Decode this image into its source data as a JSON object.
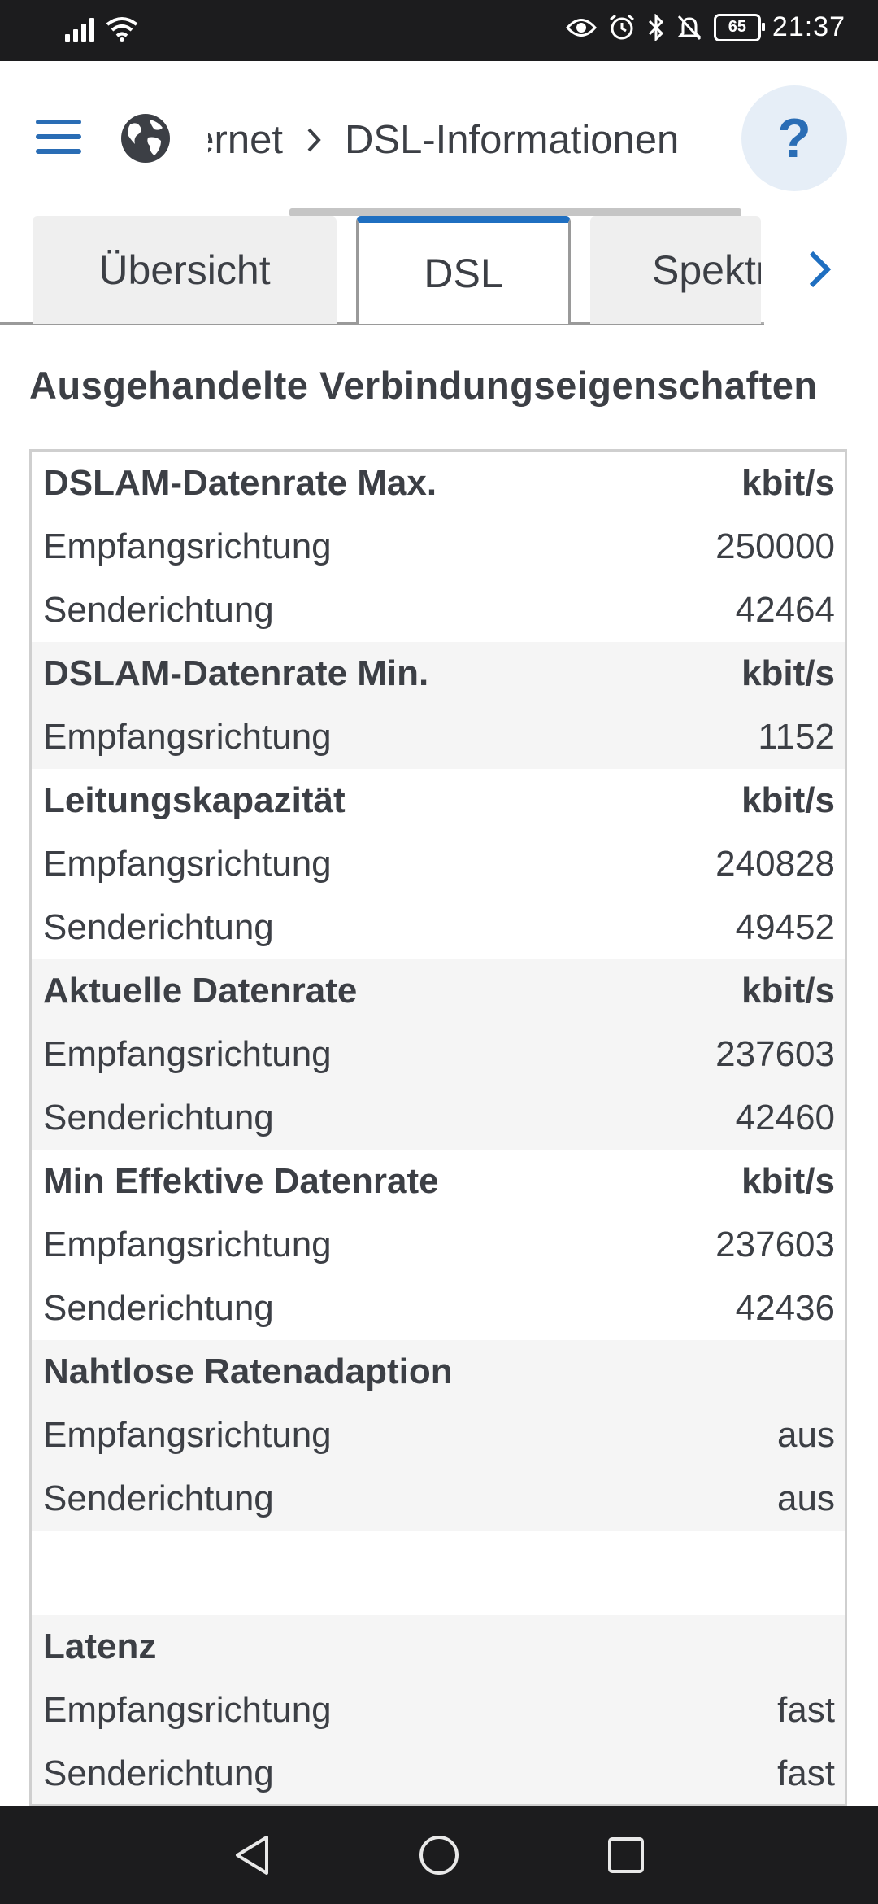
{
  "status_bar": {
    "icons": [
      "signal-icon",
      "wifi-icon",
      "eye-icon",
      "alarm-icon",
      "bluetooth-icon",
      "mute-icon",
      "battery-icon"
    ],
    "battery": "65",
    "time": "21:37"
  },
  "header": {
    "breadcrumb": {
      "parent": "Internet",
      "current": "DSL-Informationen"
    },
    "help_label": "?"
  },
  "tabs": [
    {
      "label": "Übersicht",
      "active": false
    },
    {
      "label": "DSL",
      "active": true
    },
    {
      "label": "Spektrum",
      "active": false
    }
  ],
  "section_title": "Ausgehandelte Verbindungseigenschaften",
  "table": {
    "groups": [
      {
        "title": "DSLAM-Datenrate Max.",
        "unit": "kbit/s",
        "rows": [
          {
            "label": "Empfangsrichtung",
            "value": "250000"
          },
          {
            "label": "Senderichtung",
            "value": "42464"
          }
        ]
      },
      {
        "title": "DSLAM-Datenrate Min.",
        "unit": "kbit/s",
        "rows": [
          {
            "label": "Empfangsrichtung",
            "value": "1152"
          }
        ]
      },
      {
        "title": "Leitungskapazität",
        "unit": "kbit/s",
        "rows": [
          {
            "label": "Empfangsrichtung",
            "value": "240828"
          },
          {
            "label": "Senderichtung",
            "value": "49452"
          }
        ]
      },
      {
        "title": "Aktuelle Datenrate",
        "unit": "kbit/s",
        "rows": [
          {
            "label": "Empfangsrichtung",
            "value": "237603"
          },
          {
            "label": "Senderichtung",
            "value": "42460"
          }
        ]
      },
      {
        "title": "Min Effektive Datenrate",
        "unit": "kbit/s",
        "rows": [
          {
            "label": "Empfangsrichtung",
            "value": "237603"
          },
          {
            "label": "Senderichtung",
            "value": "42436"
          }
        ]
      },
      {
        "title": "Nahtlose Ratenadaption",
        "unit": "",
        "rows": [
          {
            "label": "Empfangsrichtung",
            "value": "aus"
          },
          {
            "label": "Senderichtung",
            "value": "aus"
          }
        ]
      },
      {
        "title": "Latenz",
        "unit": "",
        "rows": [
          {
            "label": "Empfangsrichtung",
            "value": "fast"
          },
          {
            "label": "Senderichtung",
            "value": "fast"
          }
        ]
      }
    ]
  },
  "colors": {
    "accent": "#1f6fc1",
    "text": "#3c3f45",
    "row_shade": "#f5f5f5",
    "system_bar": "#1c1c1e"
  }
}
